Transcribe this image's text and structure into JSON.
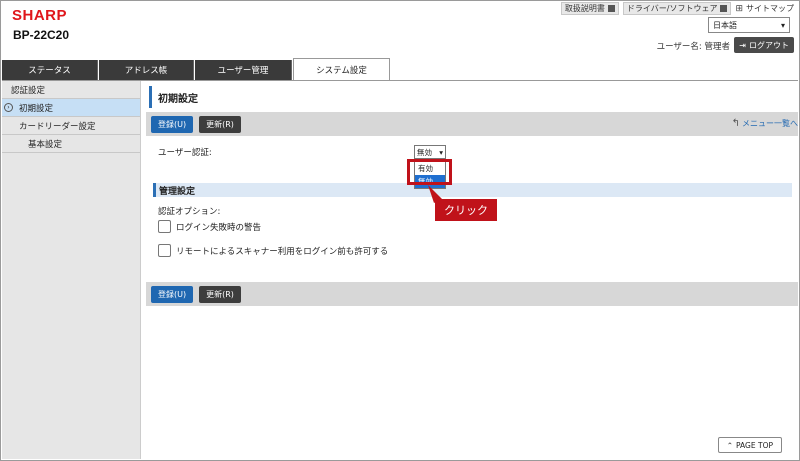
{
  "header": {
    "logo": "SHARP",
    "model": "BP-22C20",
    "links": [
      "取扱説明書",
      "ドライバー/ソフトウェア"
    ],
    "sitemap": "サイトマップ",
    "language": "日本語",
    "user_label": "ユーザー名: 管理者",
    "logout": "ログアウト"
  },
  "tabs": [
    "ステータス",
    "アドレス帳",
    "ユーザー管理",
    "システム設定"
  ],
  "sidebar": {
    "items": [
      "認証設定",
      "初期設定",
      "カードリーダー設定",
      "基本設定"
    ]
  },
  "main": {
    "title": "初期設定",
    "register_button": "登録(U)",
    "refresh_button": "更新(R)",
    "menu_back": "メニュー一覧へ",
    "user_auth_label": "ユーザー認証:",
    "user_auth_value": "無効",
    "dropdown_options": [
      "有効",
      "無効"
    ],
    "callout": "クリック",
    "section_title": "管理設定",
    "auth_options_label": "認証オプション:",
    "checkbox1": "ログイン失敗時の警告",
    "checkbox2": "リモートによるスキャナー利用をログイン前も許可する",
    "page_top": "PAGE TOP"
  },
  "colors": {
    "accent_blue": "#1f67b1",
    "brand_red": "#e0161b",
    "callout_red": "#c0121a",
    "tab_dark": "#3a3a3a"
  }
}
